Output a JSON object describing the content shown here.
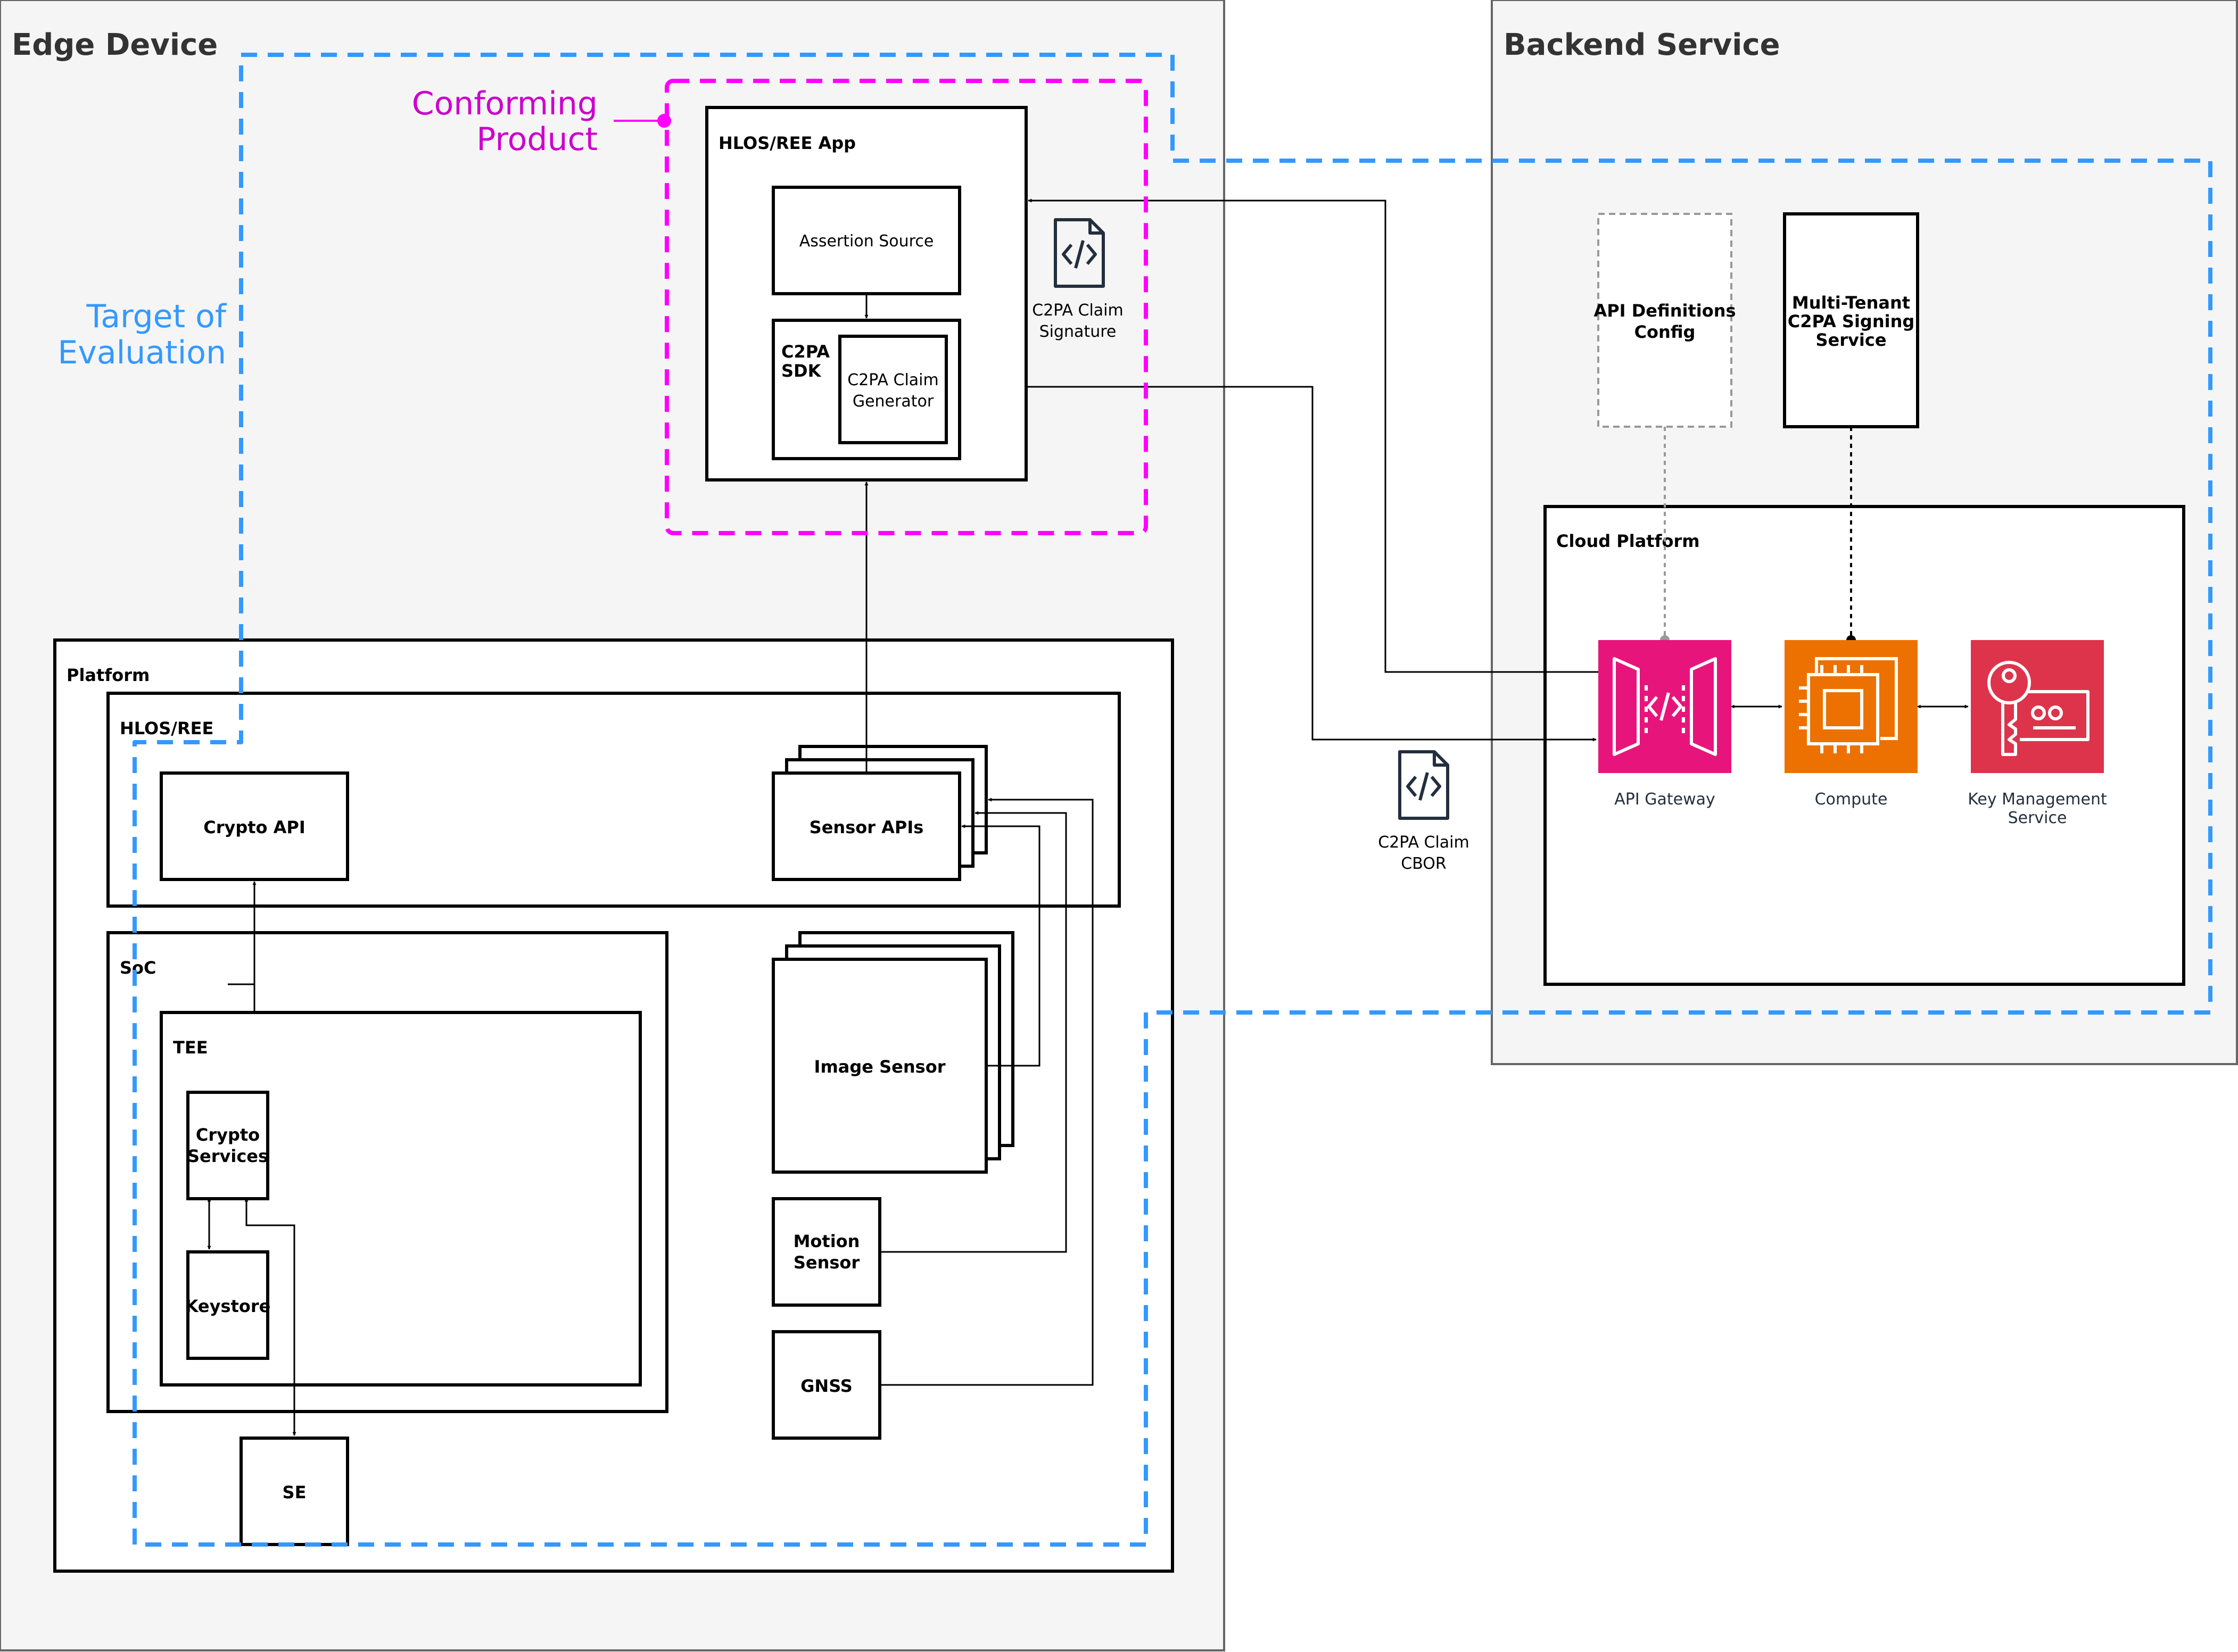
{
  "regions": {
    "edge_device": "Edge Device",
    "backend_service": "Backend Service",
    "target_of_evaluation": [
      "Target of",
      "Evaluation"
    ],
    "conforming_product": [
      "Conforming",
      "Product"
    ]
  },
  "components": {
    "hlos_app": "HLOS/REE App",
    "assertion_source": "Assertion Source",
    "c2pa_sdk": [
      "C2PA",
      "SDK"
    ],
    "claim_generator": [
      "C2PA Claim",
      "Generator"
    ],
    "platform": "Platform",
    "hlos_ree": "HLOS/REE",
    "crypto_api": "Crypto API",
    "sensor_apis": "Sensor APIs",
    "soc": "SoC",
    "tee": "TEE",
    "crypto_services": [
      "Crypto",
      "Services"
    ],
    "keystore": "Keystore",
    "se": "SE",
    "image_sensor": "Image Sensor",
    "motion_sensor": [
      "Motion",
      "Sensor"
    ],
    "gnss": "GNSS",
    "api_definitions": [
      "API Definitions",
      "Config"
    ],
    "signing_service": [
      "Multi-Tenant",
      "C2PA Signing",
      "Service"
    ],
    "cloud_platform": "Cloud Platform",
    "api_gateway": "API Gateway",
    "compute": "Compute",
    "kms": [
      "Key Management",
      "Service"
    ]
  },
  "documents": {
    "claim_signature": [
      "C2PA Claim",
      "Signature"
    ],
    "claim_cbor": [
      "C2PA Claim",
      "CBOR"
    ]
  },
  "colors": {
    "region_fill": "#f5f5f5",
    "region_stroke": "#666666",
    "toe": "#3399ff",
    "conforming": "#ff00ff",
    "conforming_text": "#cc00cc",
    "api_gateway": "#e7157b",
    "compute": "#ed7100",
    "kms": "#dd344c",
    "dashed_grey": "#999999"
  },
  "icons": [
    "code-file-icon",
    "api-gateway-icon",
    "chip-icon",
    "key-icon"
  ]
}
